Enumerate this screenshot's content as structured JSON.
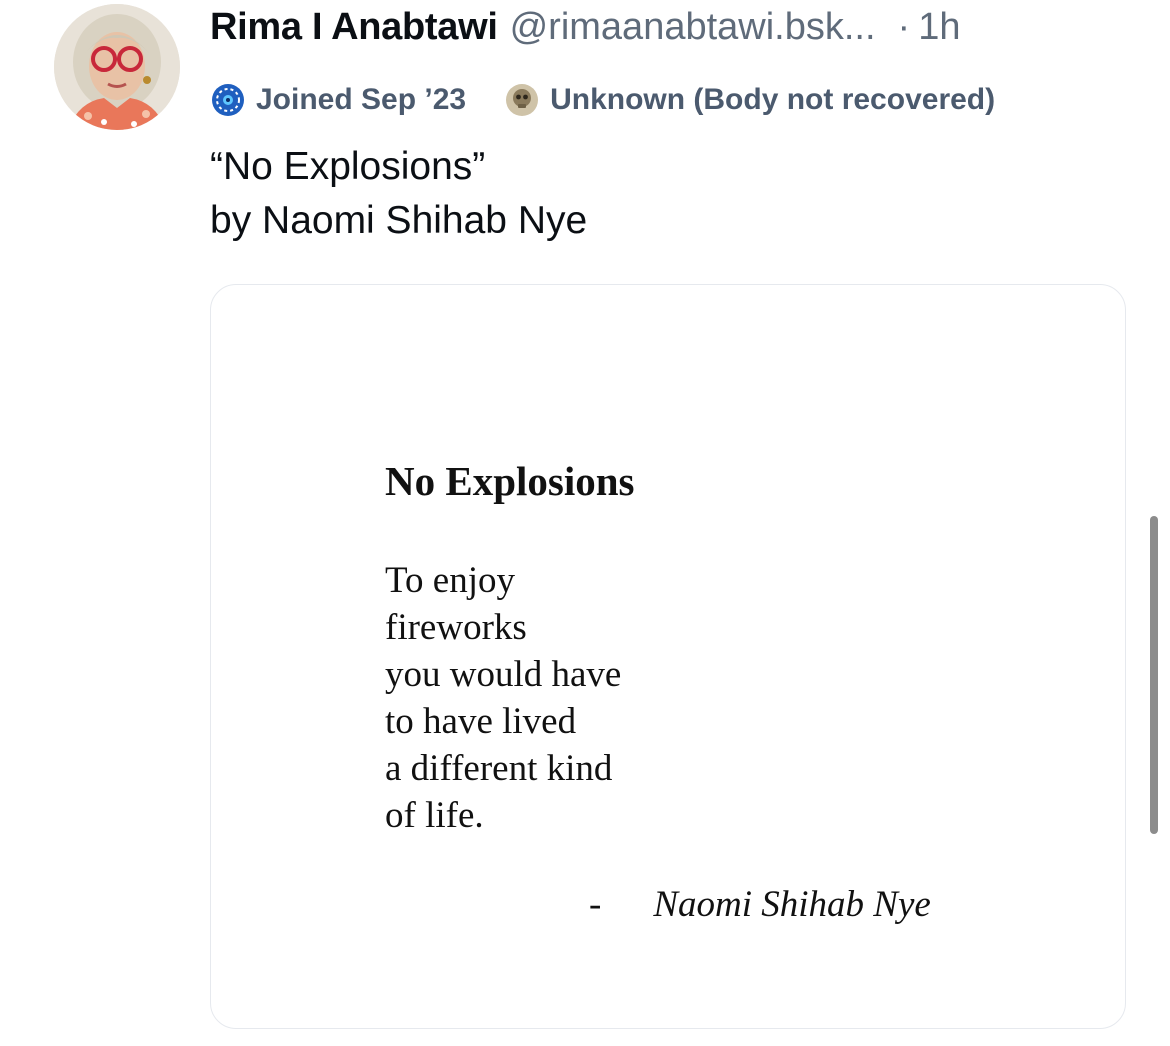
{
  "post": {
    "author": {
      "display_name": "Rima I Anabtawi",
      "handle": "@rimaanabtawi.bsk...",
      "time_separator": "·",
      "time": "1h"
    },
    "badges": [
      {
        "icon": "globe-badge-icon",
        "label": "Joined Sep ’23"
      },
      {
        "icon": "skull-badge-icon",
        "label": "Unknown (Body not recovered)"
      }
    ],
    "text_lines": [
      "“No Explosions”",
      "by Naomi Shihab Nye"
    ],
    "embed": {
      "poem_title": "No Explosions",
      "poem_lines": [
        "To enjoy",
        "fireworks",
        "you would have",
        "to have lived",
        "a different kind",
        "of life."
      ],
      "signature_dash": "-",
      "signature": "Naomi Shihab Nye"
    }
  },
  "colors": {
    "text_primary": "#0b0f14",
    "text_secondary": "#5f6b7a",
    "badge_text": "#4b5a6e",
    "embed_border": "#e6e9ee",
    "scrollbar": "#8c8c8c"
  }
}
